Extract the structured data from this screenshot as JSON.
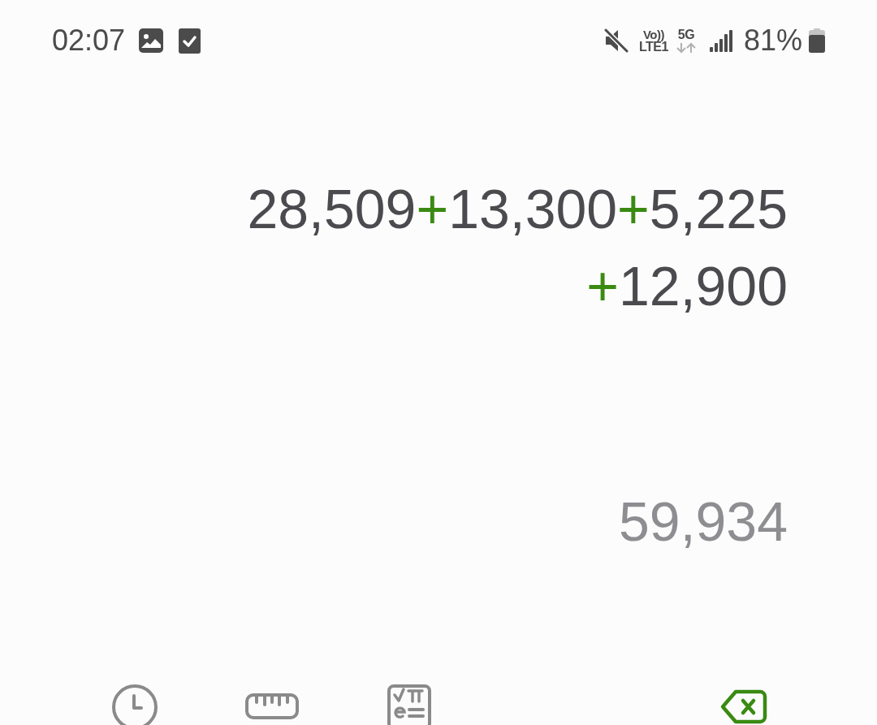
{
  "status_bar": {
    "time": "02:07",
    "volte": "Vo))",
    "lte": "LTE1",
    "network": "5G",
    "battery": "81%"
  },
  "expression": {
    "lines": [
      [
        {
          "kind": "number",
          "text": "28,509"
        },
        {
          "kind": "operator",
          "text": "+"
        },
        {
          "kind": "number",
          "text": "13,300"
        },
        {
          "kind": "operator",
          "text": "+"
        },
        {
          "kind": "number",
          "text": "5,225"
        }
      ],
      [
        {
          "kind": "operator",
          "text": "+"
        },
        {
          "kind": "number",
          "text": "12,900"
        }
      ]
    ]
  },
  "result": "59,934"
}
